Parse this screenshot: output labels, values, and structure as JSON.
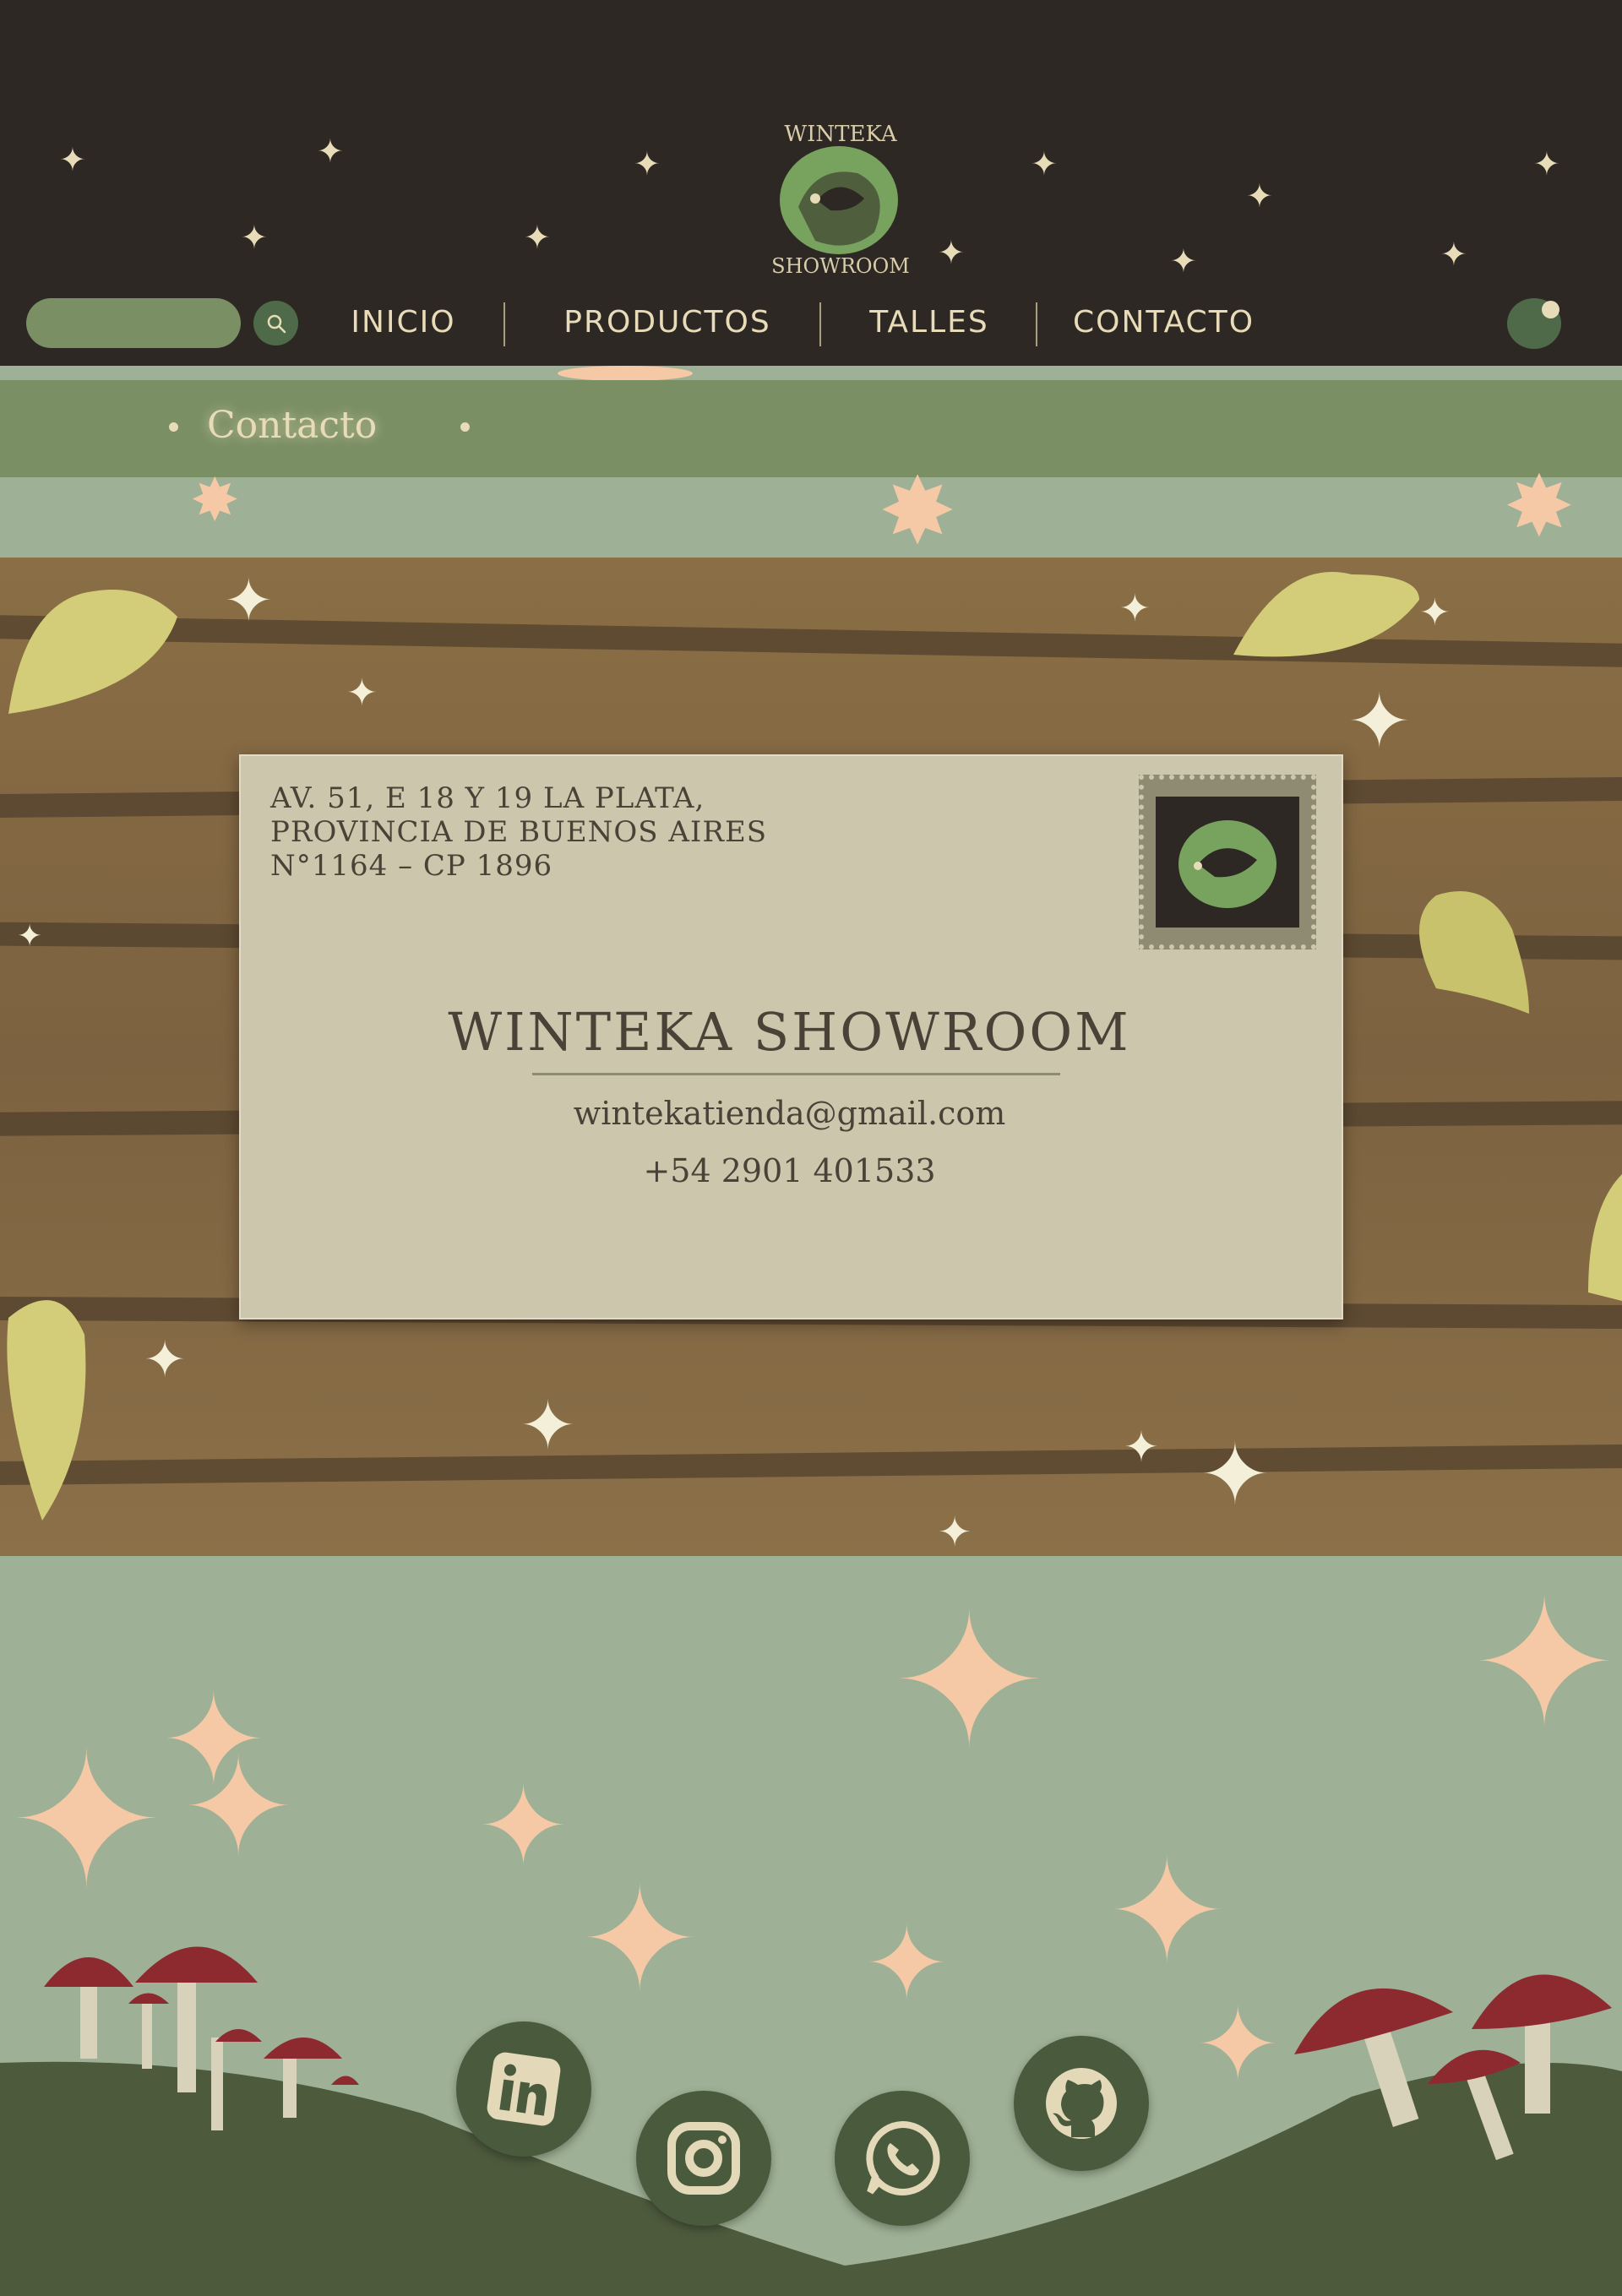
{
  "header": {
    "logo_top_text": "WINTEKA",
    "logo_bottom_text": "SHOWROOM",
    "search": {
      "value": "",
      "placeholder": ""
    },
    "nav": [
      {
        "label": "INICIO"
      },
      {
        "label": "PRODUCTOS"
      },
      {
        "label": "TALLES"
      },
      {
        "label": "CONTACTO"
      }
    ]
  },
  "breadcrumb": {
    "label": "Contacto"
  },
  "envelope": {
    "address_line1": "AV. 51, E 18 Y 19 LA PLATA,",
    "address_line2": "PROVINCIA DE BUENOS AIRES",
    "address_line3": "N°1164 – CP 1896",
    "title": "WINTEKA SHOWROOM",
    "email": "wintekatienda@gmail.com",
    "phone": "+54 2901 401533"
  },
  "social": [
    {
      "icon": "linkedin-icon"
    },
    {
      "icon": "instagram-icon"
    },
    {
      "icon": "whatsapp-icon"
    },
    {
      "icon": "github-icon"
    }
  ],
  "colors": {
    "header_bg": "#2d2823",
    "sage": "#9eb095",
    "green": "#7b8f65",
    "dark_green": "#4a5a3c",
    "cream": "#e8dcb8",
    "peach": "#f5c9a6",
    "envelope": "#ccc6ad",
    "wood": "#8a6e45",
    "mushroom_red": "#8c2a30"
  }
}
